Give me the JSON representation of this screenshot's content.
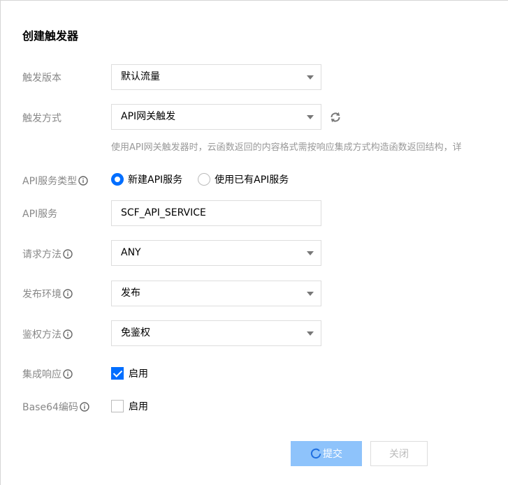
{
  "dialog": {
    "title": "创建触发器"
  },
  "form": {
    "version": {
      "label": "触发版本",
      "value": "默认流量"
    },
    "method": {
      "label": "触发方式",
      "value": "API网关触发",
      "hint": "使用API网关触发器时，云函数返回的内容格式需按响应集成方式构造函数返回结构，详"
    },
    "service_type": {
      "label": "API服务类型",
      "options": [
        "新建API服务",
        "使用已有API服务"
      ],
      "selected": "新建API服务"
    },
    "service": {
      "label": "API服务",
      "value": "SCF_API_SERVICE"
    },
    "request_method": {
      "label": "请求方法",
      "value": "ANY"
    },
    "environment": {
      "label": "发布环境",
      "value": "发布"
    },
    "auth": {
      "label": "鉴权方法",
      "value": "免鉴权"
    },
    "integration": {
      "label": "集成响应",
      "checkbox_label": "启用",
      "checked": true
    },
    "base64": {
      "label": "Base64编码",
      "checkbox_label": "启用",
      "checked": false
    }
  },
  "buttons": {
    "submit": "提交",
    "close": "关闭"
  },
  "colors": {
    "primary": "#006eff",
    "submit_disabled": "#8ec3fb",
    "label": "#888888"
  },
  "icons": {
    "info": "info-icon",
    "refresh": "refresh-icon",
    "caret": "chevron-down-icon",
    "spinner": "loading-spinner-icon"
  }
}
